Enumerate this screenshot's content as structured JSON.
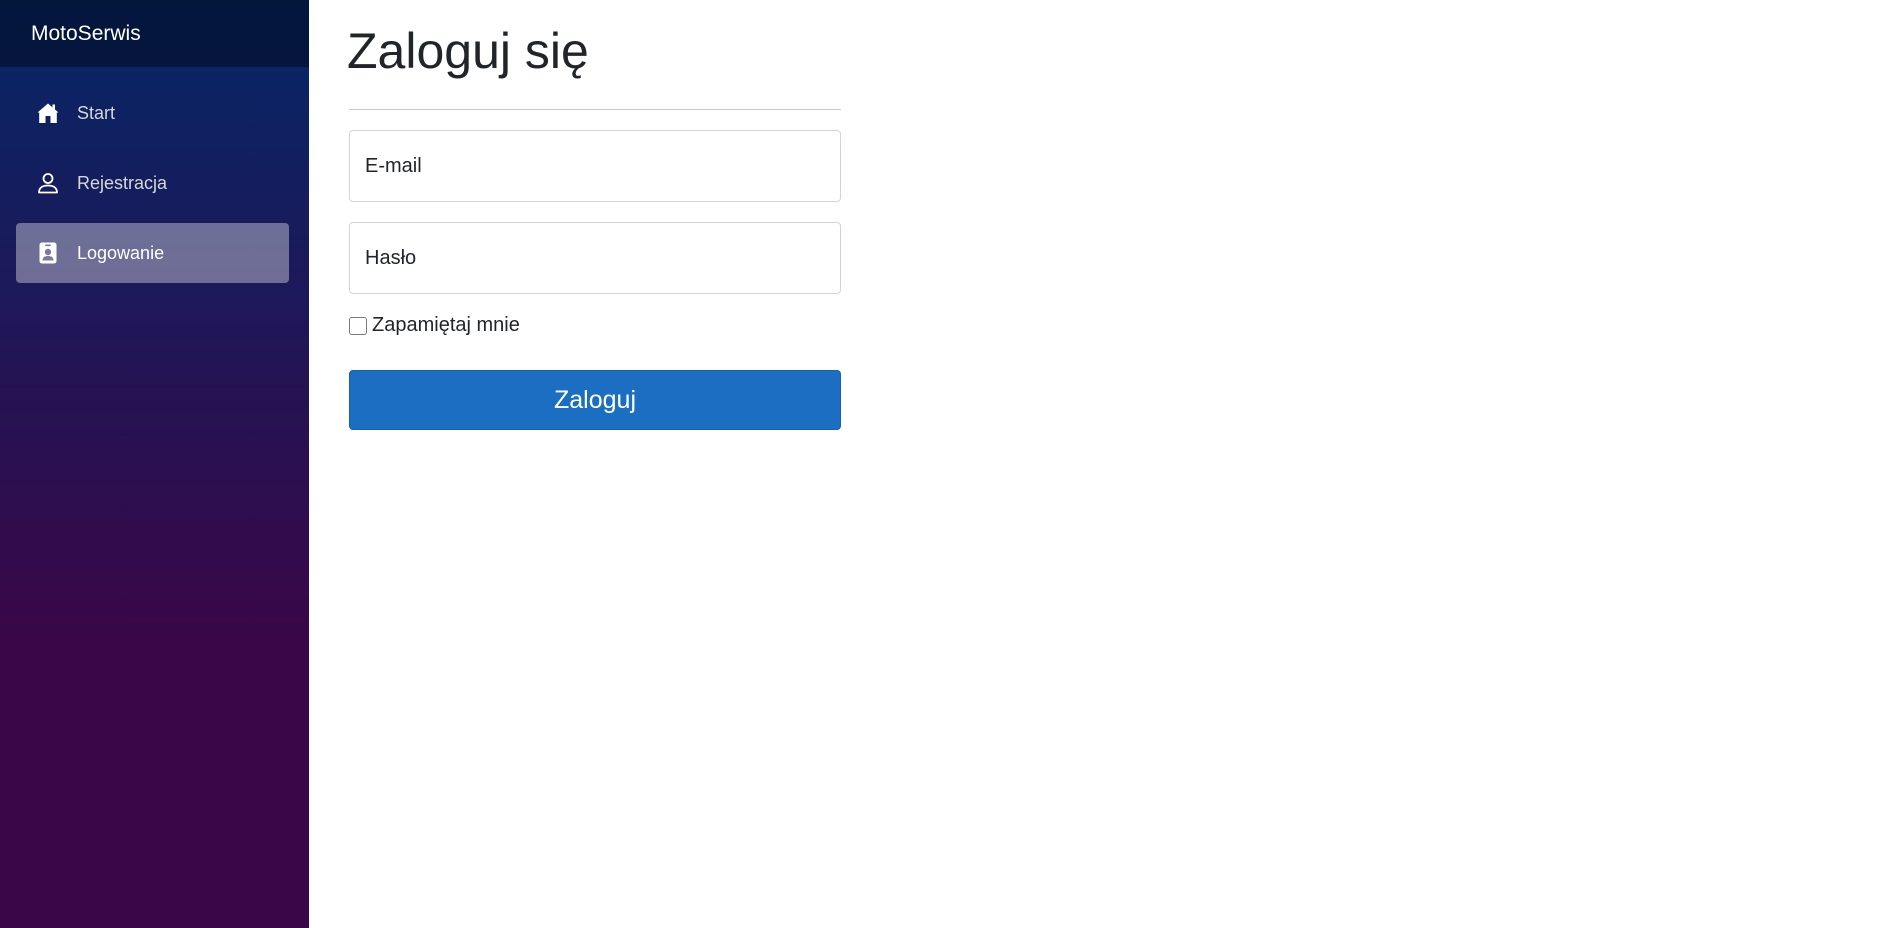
{
  "app": {
    "brand": "MotoSerwis"
  },
  "sidebar": {
    "items": [
      {
        "label": "Start",
        "icon": "home-icon",
        "active": false
      },
      {
        "label": "Rejestracja",
        "icon": "person-icon",
        "active": false
      },
      {
        "label": "Logowanie",
        "icon": "person-badge-icon",
        "active": true
      }
    ]
  },
  "main": {
    "title": "Zaloguj się",
    "form": {
      "email_placeholder": "E-mail",
      "password_placeholder": "Hasło",
      "remember_label": "Zapamiętaj mnie",
      "remember_checked": false,
      "submit_label": "Zaloguj"
    }
  },
  "colors": {
    "sidebar_gradient_top": "#052767",
    "sidebar_gradient_bottom": "#3a0647",
    "primary_button": "#1b6ec2"
  }
}
